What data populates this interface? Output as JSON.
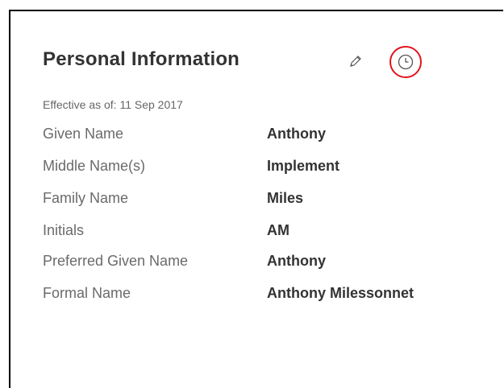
{
  "section": {
    "title": "Personal Information",
    "effective_label": "Effective as of: 11 Sep 2017"
  },
  "icons": {
    "edit": "pencil-icon",
    "history": "clock-icon",
    "highlight_color": "#e0141e"
  },
  "fields": [
    {
      "label": "Given Name",
      "value": "Anthony"
    },
    {
      "label": "Middle Name(s)",
      "value": "Implement"
    },
    {
      "label": "Family Name",
      "value": "Miles"
    },
    {
      "label": "Initials",
      "value": "AM"
    },
    {
      "label": "Preferred Given Name",
      "value": "Anthony"
    },
    {
      "label": "Formal Name",
      "value": "Anthony Milessonnet"
    }
  ]
}
